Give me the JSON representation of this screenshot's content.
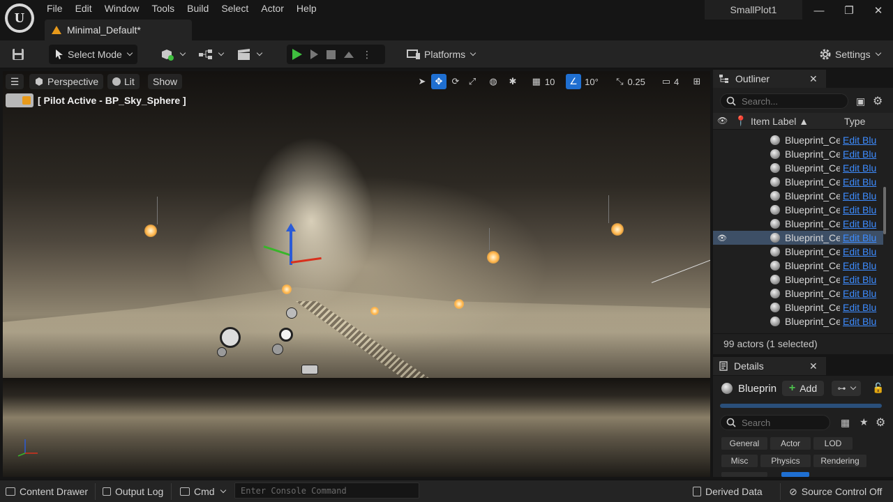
{
  "app": {
    "logo_text": "U",
    "project": "SmallPlot1",
    "document_tab": "Minimal_Default*",
    "window_controls": {
      "minimize": "—",
      "maximize": "❐",
      "close": "✕"
    }
  },
  "menu": [
    "File",
    "Edit",
    "Window",
    "Tools",
    "Build",
    "Select",
    "Actor",
    "Help"
  ],
  "toolbar": {
    "select_mode": "Select Mode",
    "platforms": "Platforms",
    "settings": "Settings"
  },
  "viewport": {
    "view_mode": "Perspective",
    "lighting": "Lit",
    "show": "Show",
    "pilot_banner": "[ Pilot Active - BP_Sky_Sphere ]",
    "grid_snap": "10",
    "rotation_snap": "10°",
    "scale_snap": "0.25",
    "camera_speed": "4"
  },
  "outliner": {
    "title": "Outliner",
    "search_placeholder": "Search...",
    "col_label": "Item Label ▲",
    "col_type": "Type",
    "rows": [
      {
        "label": "Blueprint_Cei",
        "type": "Edit Blu",
        "selected": false
      },
      {
        "label": "Blueprint_Cei",
        "type": "Edit Blu",
        "selected": false
      },
      {
        "label": "Blueprint_Cei",
        "type": "Edit Blu",
        "selected": false
      },
      {
        "label": "Blueprint_Cei",
        "type": "Edit Blu",
        "selected": false
      },
      {
        "label": "Blueprint_Cei",
        "type": "Edit Blu",
        "selected": false
      },
      {
        "label": "Blueprint_Cei",
        "type": "Edit Blu",
        "selected": false
      },
      {
        "label": "Blueprint_Cei",
        "type": "Edit Blu",
        "selected": false
      },
      {
        "label": "Blueprint_Cei",
        "type": "Edit Blu",
        "selected": true
      },
      {
        "label": "Blueprint_Cei",
        "type": "Edit Blu",
        "selected": false
      },
      {
        "label": "Blueprint_Cei",
        "type": "Edit Blu",
        "selected": false
      },
      {
        "label": "Blueprint_Cei",
        "type": "Edit Blu",
        "selected": false
      },
      {
        "label": "Blueprint_Cei",
        "type": "Edit Blu",
        "selected": false
      },
      {
        "label": "Blueprint_Cei",
        "type": "Edit Blu",
        "selected": false
      },
      {
        "label": "Blueprint_Cei",
        "type": "Edit Blu",
        "selected": false
      }
    ],
    "status": "99 actors (1 selected)"
  },
  "details": {
    "title": "Details",
    "actor_name": "Blueprin",
    "add_label": "Add",
    "search_placeholder": "Search",
    "categories": [
      "General",
      "Actor",
      "LOD",
      "Misc",
      "Physics",
      "Rendering"
    ]
  },
  "bottombar": {
    "content_drawer": "Content Drawer",
    "output_log": "Output Log",
    "cmd": "Cmd",
    "console_placeholder": "Enter Console Command",
    "derived_data": "Derived Data",
    "source_control": "Source Control Off"
  },
  "colors": {
    "accent_blue": "#1f6fd1",
    "play_green": "#3fbf3f",
    "warning_orange": "#e89a1b",
    "link_blue": "#3d8cff",
    "selection": "#3d4f66"
  }
}
